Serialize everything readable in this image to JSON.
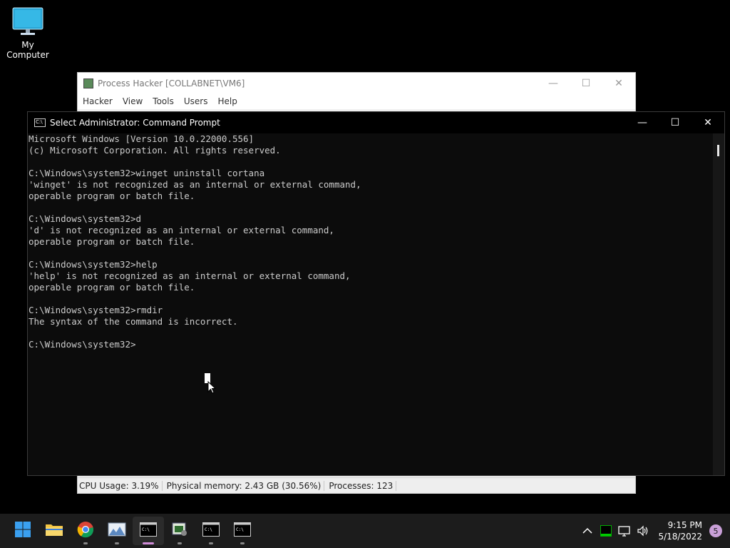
{
  "desktop": {
    "icons": [
      {
        "label": "My Computer",
        "icon": "computer-monitor-icon"
      }
    ]
  },
  "process_hacker": {
    "title": "Process Hacker [COLLABNET\\VM6]",
    "menu": [
      "Hacker",
      "View",
      "Tools",
      "Users",
      "Help"
    ],
    "status": {
      "cpu": "CPU Usage: 3.19%",
      "memory": "Physical memory: 2.43 GB (30.56%)",
      "processes": "Processes: 123"
    }
  },
  "cmd": {
    "title": "Select Administrator: Command Prompt",
    "lines": [
      "Microsoft Windows [Version 10.0.22000.556]",
      "(c) Microsoft Corporation. All rights reserved.",
      "",
      "C:\\Windows\\system32>winget uninstall cortana",
      "'winget' is not recognized as an internal or external command,",
      "operable program or batch file.",
      "",
      "C:\\Windows\\system32>d",
      "'d' is not recognized as an internal or external command,",
      "operable program or batch file.",
      "",
      "C:\\Windows\\system32>help",
      "'help' is not recognized as an internal or external command,",
      "operable program or batch file.",
      "",
      "C:\\Windows\\system32>rmdir",
      "The syntax of the command is incorrect.",
      "",
      "C:\\Windows\\system32>"
    ]
  },
  "taskbar": {
    "apps": [
      {
        "name": "start-button",
        "icon": "windows-logo-icon",
        "running": false,
        "active": false
      },
      {
        "name": "file-explorer-button",
        "icon": "folder-icon",
        "running": false,
        "active": false
      },
      {
        "name": "chrome-button",
        "icon": "chrome-icon",
        "running": true,
        "active": false
      },
      {
        "name": "photo-viewer-button",
        "icon": "photo-icon",
        "running": true,
        "active": false
      },
      {
        "name": "cmd-active-button",
        "icon": "terminal-icon",
        "running": true,
        "active": true
      },
      {
        "name": "process-hacker-button",
        "icon": "process-hacker-icon",
        "running": true,
        "active": false
      },
      {
        "name": "cmd-button-2",
        "icon": "terminal-icon",
        "running": true,
        "active": false
      },
      {
        "name": "cmd-button-3",
        "icon": "terminal-icon",
        "running": true,
        "active": false
      }
    ],
    "clock": {
      "time": "9:15 PM",
      "date": "5/18/2022"
    },
    "notifications": "5"
  },
  "colors": {
    "terminal_bg": "#0c0c0c",
    "terminal_text": "#cccccc",
    "taskbar_bg": "#1c1c1c",
    "active_indicator": "#d08cd8"
  }
}
